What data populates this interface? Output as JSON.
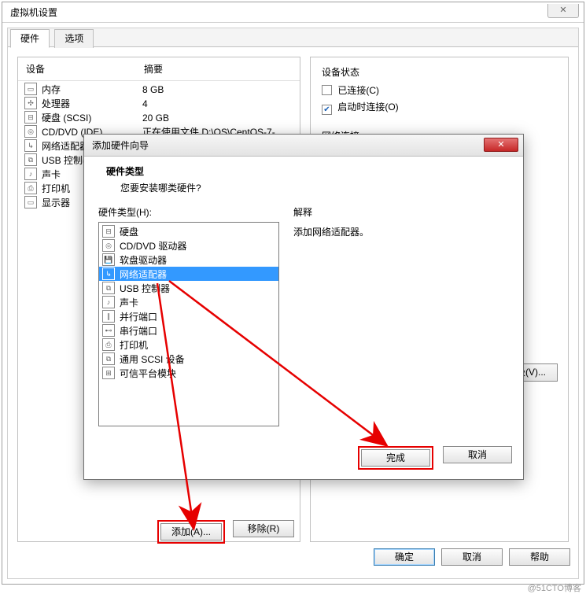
{
  "window": {
    "title": "虚拟机设置",
    "close_glyph": "✕"
  },
  "tabs": {
    "hardware": "硬件",
    "options": "选项"
  },
  "dev_header": {
    "device": "设备",
    "summary": "摘要"
  },
  "devices": [
    {
      "icon": "▭",
      "name": "内存",
      "summary": "8 GB"
    },
    {
      "icon": "✣",
      "name": "处理器",
      "summary": "4"
    },
    {
      "icon": "⊟",
      "name": "硬盘 (SCSI)",
      "summary": "20 GB"
    },
    {
      "icon": "◎",
      "name": "CD/DVD (IDE)",
      "summary": "正在使用文件 D:\\OS\\CentOS-7-..."
    },
    {
      "icon": "↳",
      "name": "网络适配器",
      "summary": ""
    },
    {
      "icon": "⧉",
      "name": "USB 控制器",
      "summary": ""
    },
    {
      "icon": "♪",
      "name": "声卡",
      "summary": ""
    },
    {
      "icon": "⎙",
      "name": "打印机",
      "summary": ""
    },
    {
      "icon": "▭",
      "name": "显示器",
      "summary": ""
    }
  ],
  "status": {
    "group": "设备状态",
    "connected": "已连接(C)",
    "connect_on_start": "启动时连接(O)",
    "connected_checked": false,
    "start_checked": true
  },
  "netconn": {
    "group": "网络连接"
  },
  "buttons": {
    "advanced": "高级(V)...",
    "add": "添加(A)...",
    "remove": "移除(R)",
    "ok": "确定",
    "cancel": "取消",
    "help": "帮助"
  },
  "wizard": {
    "title": "添加硬件向导",
    "close_glyph": "✕",
    "head_title": "硬件类型",
    "head_sub": "您要安装哪类硬件?",
    "list_label": "硬件类型(H):",
    "explain_label": "解释",
    "explain_text": "添加网络适配器。",
    "items": [
      {
        "icon": "⊟",
        "label": "硬盘"
      },
      {
        "icon": "◎",
        "label": "CD/DVD 驱动器"
      },
      {
        "icon": "💾",
        "label": "软盘驱动器"
      },
      {
        "icon": "↳",
        "label": "网络适配器",
        "selected": true
      },
      {
        "icon": "⧉",
        "label": "USB 控制器"
      },
      {
        "icon": "♪",
        "label": "声卡"
      },
      {
        "icon": "∥",
        "label": "并行端口"
      },
      {
        "icon": "⊷",
        "label": "串行端口"
      },
      {
        "icon": "⎙",
        "label": "打印机"
      },
      {
        "icon": "⧉",
        "label": "通用 SCSI 设备"
      },
      {
        "icon": "⊞",
        "label": "可信平台模块"
      }
    ],
    "finish": "完成",
    "cancel": "取消"
  },
  "watermark": "@51CTO博客"
}
